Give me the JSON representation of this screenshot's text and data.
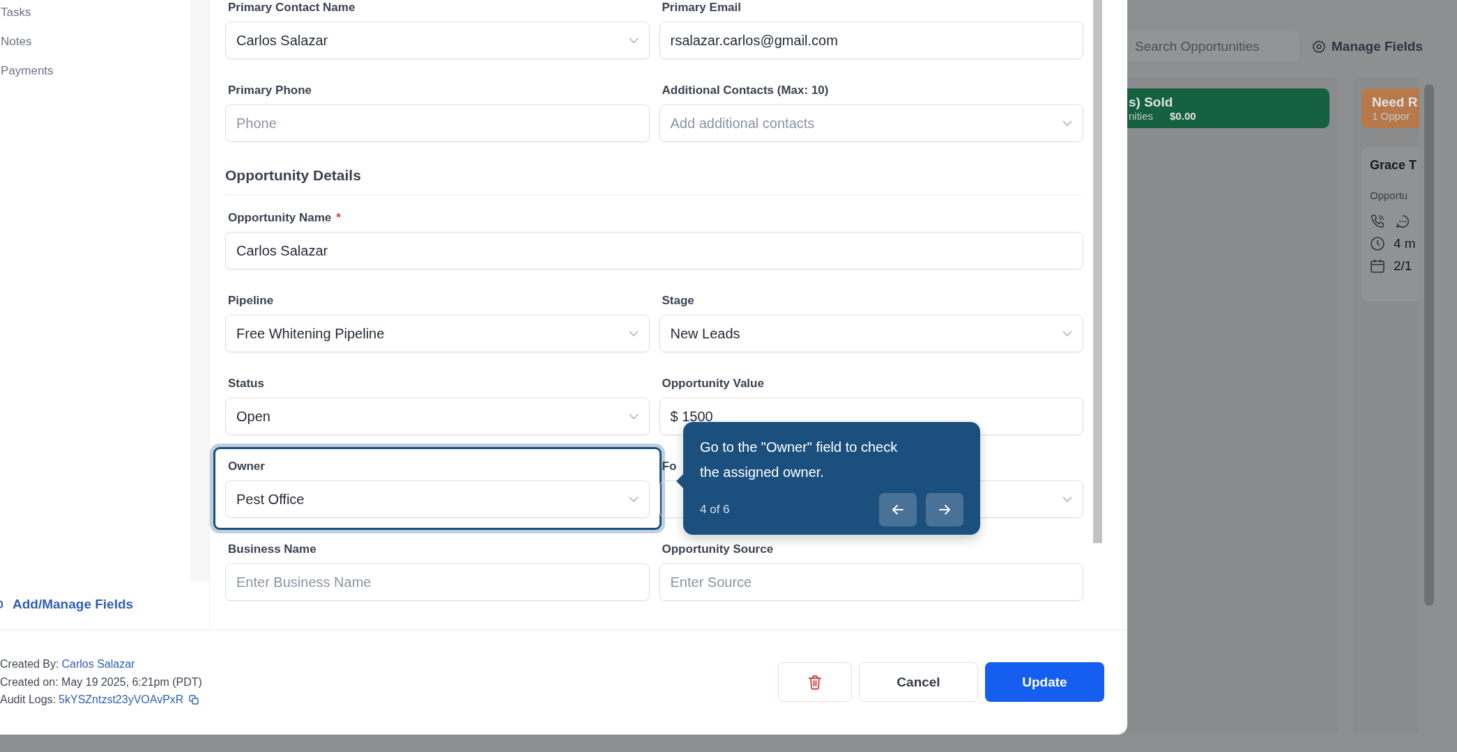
{
  "sidebar": {
    "items": [
      "Tasks",
      "Notes",
      "Payments"
    ],
    "manage_link": "Add/Manage Fields"
  },
  "form": {
    "contact_fields": [
      {
        "label": "Primary Contact Name",
        "kind": "select",
        "value": "Carlos Salazar",
        "highlighted": false
      },
      {
        "label": "Primary Email",
        "kind": "text",
        "value": "rsalazar.carlos@gmail.com",
        "highlighted": false
      },
      {
        "label": "Primary Phone",
        "kind": "text",
        "placeholder": "Phone",
        "highlighted": false
      },
      {
        "label": "Additional Contacts (Max: 10)",
        "kind": "select",
        "placeholder": "Add additional contacts",
        "highlighted": false
      }
    ],
    "section_title": "Opportunity Details",
    "opportunity_fields": [
      {
        "label": "Opportunity Name",
        "required_mark": "*",
        "kind": "text",
        "value": "Carlos Salazar",
        "full_width": true,
        "highlighted": false
      },
      {
        "label": "Pipeline",
        "kind": "select",
        "value": "Free Whitening Pipeline",
        "highlighted": false
      },
      {
        "label": "Stage",
        "kind": "select",
        "value": "New Leads",
        "highlighted": false
      },
      {
        "label": "Status",
        "kind": "select",
        "value": "Open",
        "highlighted": false
      },
      {
        "label": "Opportunity Value",
        "kind": "text",
        "value": "$ 1500",
        "highlighted": false
      },
      {
        "label": "Owner",
        "kind": "select",
        "value": "Pest Office",
        "highlighted": true
      },
      {
        "label": "Fo",
        "kind": "select",
        "highlighted": false
      },
      {
        "label": "Business Name",
        "kind": "text",
        "placeholder": "Enter Business Name",
        "highlighted": false
      },
      {
        "label": "Opportunity Source",
        "kind": "text",
        "placeholder": "Enter Source",
        "highlighted": false
      }
    ]
  },
  "tour_tooltip": {
    "text": "Go to the \"Owner\" field to check the assigned owner.",
    "step": "4 of 6"
  },
  "footer": {
    "created_by_label": "Created By:",
    "created_by": "Carlos Salazar",
    "created_on": "Created on: May 19 2025, 6:21pm (PDT)",
    "audit_label": "Audit Logs:",
    "audit_id": "5kYSZntzst23yVOAvPxR",
    "buttons": [
      "Cancel",
      "Update"
    ]
  },
  "board": {
    "search": {
      "placeholder": "Search Opportunities"
    },
    "manage_fields": "Manage Fields",
    "columns": [
      {
        "title": "s) Sold",
        "subtitle": "nities",
        "amount": "$0.00",
        "color": "#14603f"
      },
      {
        "title": "Need R",
        "subtitle": "1 Oppor",
        "color": "#b8794a"
      }
    ],
    "card": {
      "name": "Grace T",
      "label": "Opportu",
      "time": "4 m",
      "date": "2/1"
    }
  }
}
